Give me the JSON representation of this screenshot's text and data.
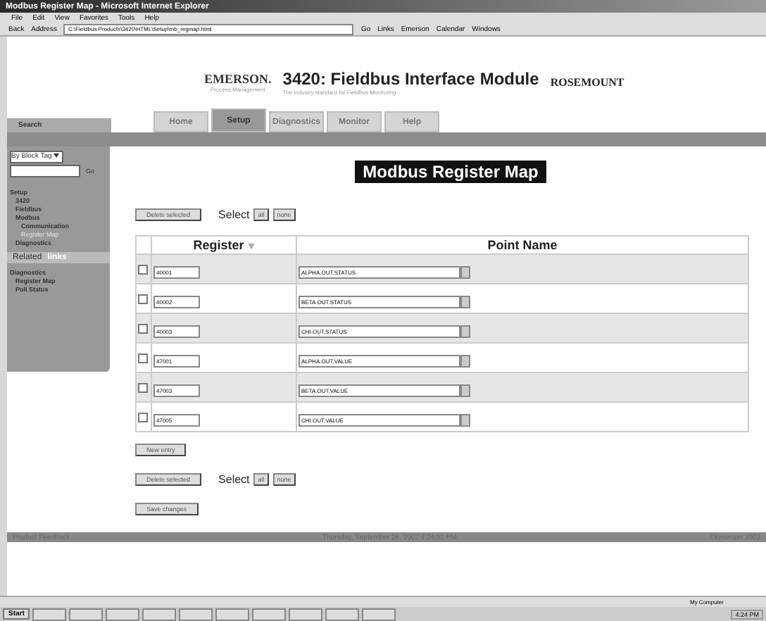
{
  "window": {
    "title": "Modbus Register Map - Microsoft Internet Explorer"
  },
  "menu": [
    "File",
    "Edit",
    "View",
    "Favorites",
    "Tools",
    "Help"
  ],
  "toolbar": {
    "back": "Back",
    "address_label": "Address",
    "address": "C:\\Fieldbus Products\\3420\\HTML\\Setup\\mb_regmap.html",
    "go": "Go",
    "links": [
      "Links",
      "Emerson",
      "Calendar",
      "Windows"
    ]
  },
  "header": {
    "brand": "EMERSON.",
    "brand_sub": "Process Management",
    "title": "3420: Fieldbus Interface Module",
    "subtitle": "The industry standard for Fieldbus Monitoring",
    "partner": "ROSEMOUNT"
  },
  "tabs": [
    {
      "label": "Home",
      "selected": false
    },
    {
      "label": "Setup",
      "selected": true
    },
    {
      "label": "Diagnostics",
      "selected": false
    },
    {
      "label": "Monitor",
      "selected": false
    },
    {
      "label": "Help",
      "selected": false
    }
  ],
  "sidebar": {
    "search_title": "Search",
    "search_by": "By Block Tag",
    "search_go": "Go",
    "items": [
      {
        "label": "Setup",
        "children": [
          {
            "label": "3420"
          },
          {
            "label": "Fieldbus"
          },
          {
            "label": "Modbus",
            "children": [
              {
                "label": "Communication"
              },
              {
                "label": "Register Map",
                "disabled": true
              }
            ]
          },
          {
            "label": "Diagnostics"
          }
        ]
      }
    ],
    "links_title": {
      "prefix": "Related",
      "label": "links"
    },
    "links": [
      {
        "label": "Diagnostics",
        "children": [
          {
            "label": "Register Map"
          },
          {
            "label": "Poll Status"
          }
        ]
      }
    ]
  },
  "page_title": "Modbus Register Map",
  "actions_top": {
    "delete": "Delete selected",
    "select": "Select",
    "all": "all",
    "none": "none"
  },
  "table": {
    "columns": [
      "Register",
      "Point Name"
    ],
    "rows": [
      {
        "checked": false,
        "register": "40001",
        "point": "ALPHA.OUT.STATUS"
      },
      {
        "checked": false,
        "register": "40002",
        "point": "BETA.OUT.STATUS"
      },
      {
        "checked": false,
        "register": "40003",
        "point": "CHI.OUT.STATUS"
      },
      {
        "checked": false,
        "register": "47001",
        "point": "ALPHA.OUT.VALUE"
      },
      {
        "checked": false,
        "register": "47003",
        "point": "BETA.OUT.VALUE"
      },
      {
        "checked": false,
        "register": "47005",
        "point": "CHI.OUT.VALUE"
      }
    ]
  },
  "new_entry": "New entry",
  "actions_bottom": {
    "delete": "Delete selected",
    "select": "Select",
    "all": "all",
    "none": "none"
  },
  "save": "Save changes",
  "footer": {
    "left": "Product Feedback",
    "center": "Thursday, September 26, 2002 4:24:51 PM",
    "right": "©Emerson 2002"
  },
  "status_bar": {
    "zone": "My Computer"
  },
  "taskbar": {
    "start": "Start",
    "clock": "4:24 PM"
  }
}
